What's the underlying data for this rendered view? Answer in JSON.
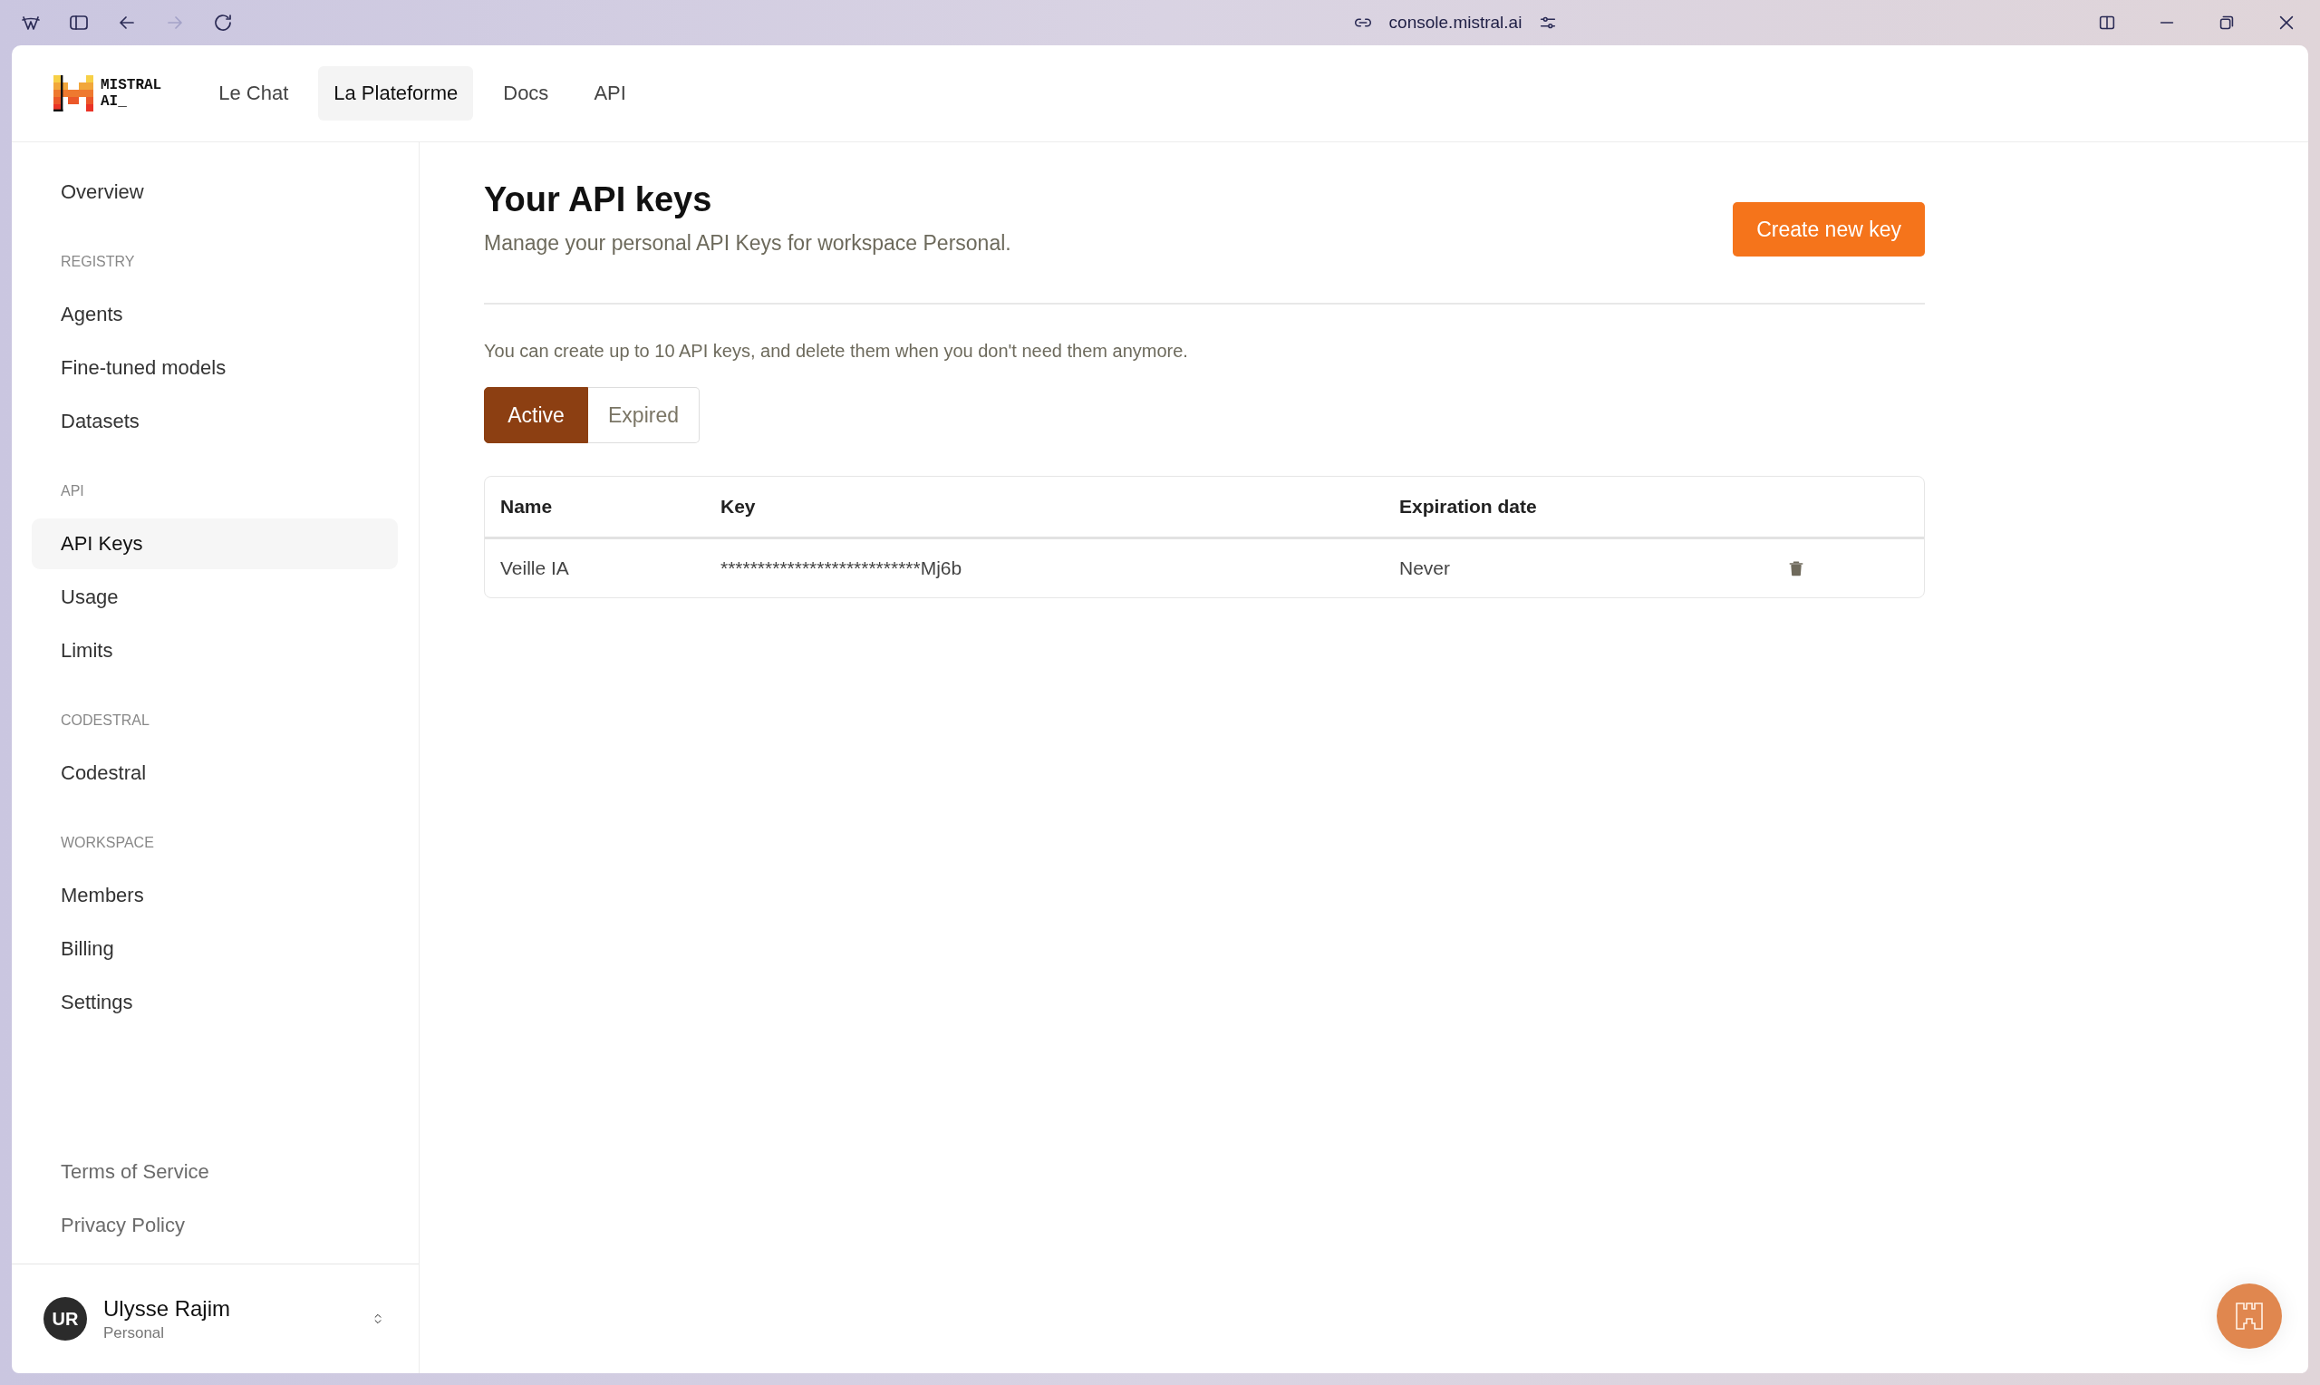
{
  "browser": {
    "url": "console.mistral.ai"
  },
  "header": {
    "logo_lines": [
      "MISTRAL",
      "AI_"
    ],
    "nav": [
      {
        "label": "Le Chat",
        "selected": false
      },
      {
        "label": "La Plateforme",
        "selected": true
      },
      {
        "label": "Docs",
        "selected": false
      },
      {
        "label": "API",
        "selected": false
      }
    ]
  },
  "sidebar": {
    "sections": [
      {
        "items": [
          {
            "label": "Overview",
            "selected": false
          }
        ]
      },
      {
        "heading": "REGISTRY",
        "items": [
          {
            "label": "Agents",
            "selected": false
          },
          {
            "label": "Fine-tuned models",
            "selected": false
          },
          {
            "label": "Datasets",
            "selected": false
          }
        ]
      },
      {
        "heading": "API",
        "items": [
          {
            "label": "API Keys",
            "selected": true
          },
          {
            "label": "Usage",
            "selected": false
          },
          {
            "label": "Limits",
            "selected": false
          }
        ]
      },
      {
        "heading": "CODESTRAL",
        "items": [
          {
            "label": "Codestral",
            "selected": false
          }
        ]
      },
      {
        "heading": "WORKSPACE",
        "items": [
          {
            "label": "Members",
            "selected": false
          },
          {
            "label": "Billing",
            "selected": false
          },
          {
            "label": "Settings",
            "selected": false
          }
        ]
      }
    ],
    "footer_links": [
      "Terms of Service",
      "Privacy Policy"
    ],
    "user": {
      "initials": "UR",
      "name": "Ulysse Rajim",
      "workspace": "Personal"
    }
  },
  "main": {
    "title": "Your API keys",
    "subtitle": "Manage your personal API Keys for workspace Personal.",
    "create_button": "Create new key",
    "info": "You can create up to 10 API keys, and delete them when you don't need them anymore.",
    "filter_tabs": [
      {
        "label": "Active",
        "selected": true
      },
      {
        "label": "Expired",
        "selected": false
      }
    ],
    "table": {
      "columns": [
        "Name",
        "Key",
        "Expiration date"
      ],
      "rows": [
        {
          "name": "Veille IA",
          "key": "***************************Mj6b",
          "expiration": "Never"
        }
      ]
    }
  }
}
